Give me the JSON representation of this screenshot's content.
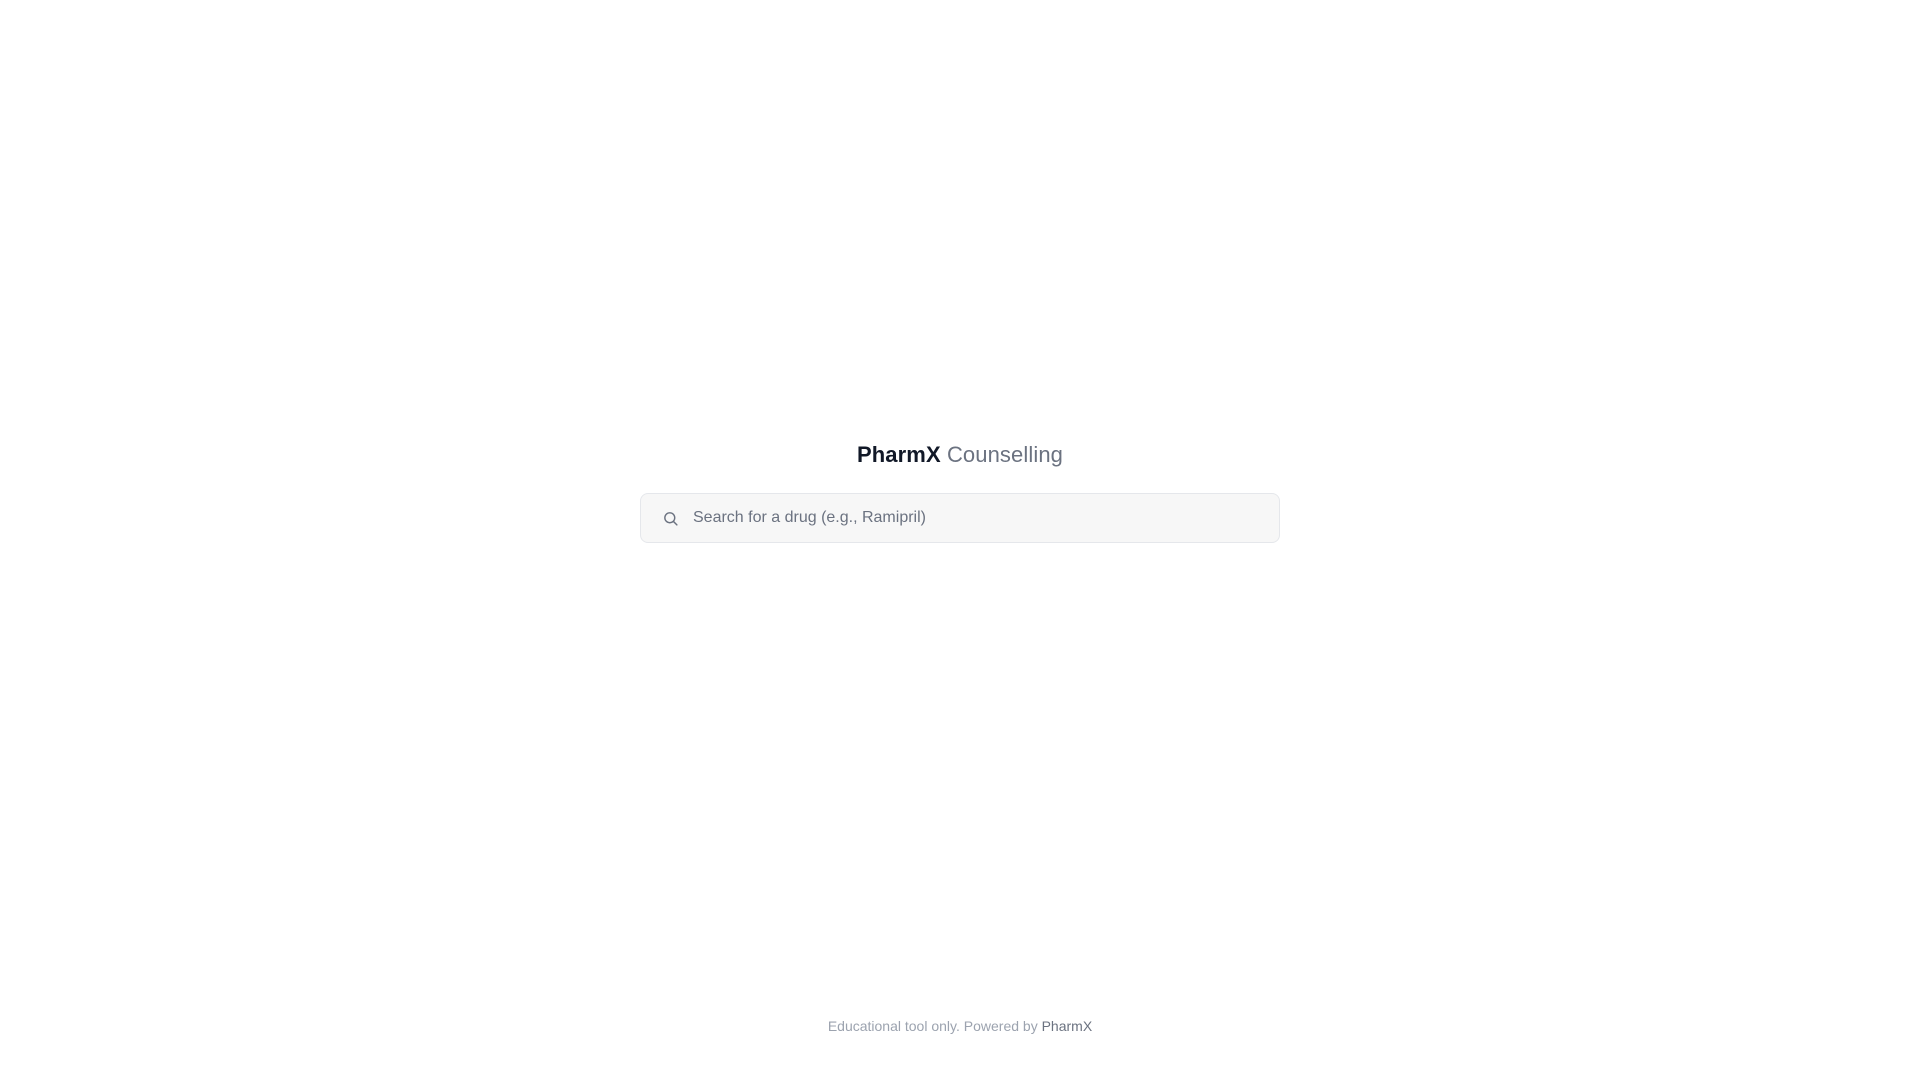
{
  "header": {
    "brand": "PharmX",
    "subtitle": "Counselling"
  },
  "search": {
    "placeholder": "Search for a drug (e.g., Ramipril)",
    "value": "",
    "icon": "search-icon"
  },
  "footer": {
    "text": "Educational tool only. Powered by",
    "link_label": "PharmX"
  },
  "colors": {
    "background": "#ffffff",
    "brand_text": "#111827",
    "muted_text": "#6b7280",
    "search_bg": "#f7f7f7",
    "search_border": "#e5e7eb",
    "footer_text": "#9ca3af"
  }
}
